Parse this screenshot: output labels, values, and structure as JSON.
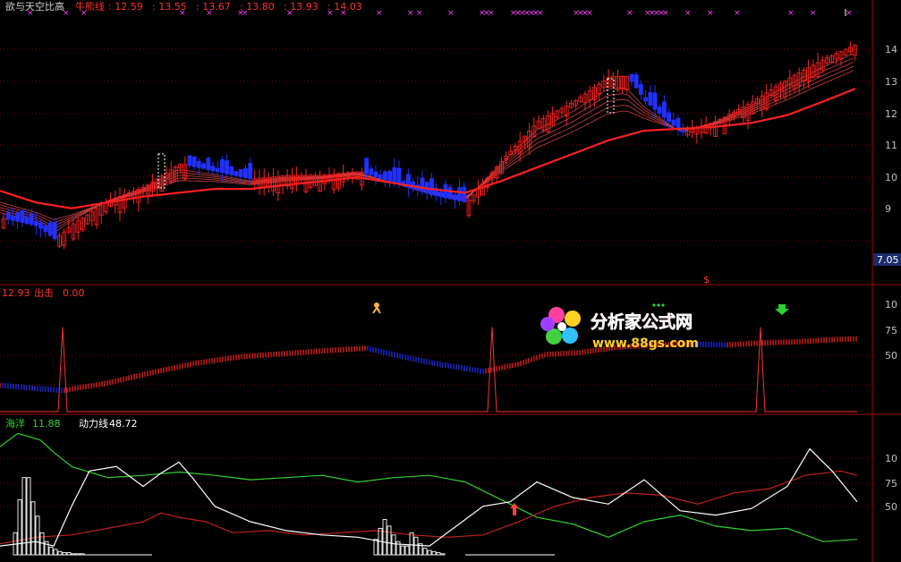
{
  "header": {
    "title": "欲与天空比高",
    "indicator_label": "牛熊线",
    "values": [
      "12.59",
      "13.55",
      "13.67",
      "13.80",
      "13.93",
      "14.03"
    ]
  },
  "panel1": {
    "axis_labels": [
      "14",
      "13",
      "12",
      "11",
      "10",
      "9"
    ],
    "price_tag": "7.05",
    "signal_char": "$"
  },
  "panel2": {
    "left_value": "12.93",
    "label": "出击",
    "value": "0.00",
    "axis_labels": [
      "10",
      "75",
      "50"
    ]
  },
  "panel3": {
    "label1": "海洋",
    "value1": "11.88",
    "label2": "动力线",
    "value2": "48.72",
    "axis_labels": [
      "10",
      "75",
      "50"
    ]
  },
  "watermark": {
    "site_name": "分析家公式网",
    "url": "www.88gs.com"
  },
  "colors": {
    "up": "#ff2020",
    "down": "#2030ff",
    "grid": "#7a0000",
    "header_text": "#ff3030",
    "white": "#ffffff",
    "green": "#30d030",
    "magenta": "#ff40ff"
  },
  "chart_data": [
    {
      "type": "line",
      "title": "欲与天空比高",
      "ylim": [
        8,
        14.5
      ],
      "series": [
        {
          "name": "牛熊线",
          "x": [
            0,
            40,
            80,
            120,
            160,
            200,
            240,
            280,
            320,
            360,
            400,
            440,
            480,
            520,
            560,
            600,
            640,
            680,
            720,
            760,
            800,
            840,
            880,
            920,
            958
          ],
          "values": [
            10.0,
            9.7,
            9.55,
            9.7,
            9.85,
            9.95,
            10.05,
            10.05,
            10.15,
            10.25,
            10.35,
            10.2,
            10.05,
            9.95,
            10.25,
            10.6,
            10.95,
            11.3,
            11.55,
            11.6,
            11.65,
            11.75,
            11.95,
            12.3,
            12.65
          ]
        },
        {
          "name": "",
          "x": [
            0,
            40,
            60,
            80,
            120,
            160,
            200,
            240,
            280,
            320,
            360,
            400,
            440,
            480,
            520,
            560,
            600,
            640,
            680,
            700,
            720,
            760,
            800,
            840,
            880,
            920,
            958
          ],
          "values": [
            9.3,
            9.1,
            8.75,
            9.15,
            9.75,
            10.1,
            10.7,
            10.5,
            10.3,
            10.4,
            10.4,
            10.5,
            10.2,
            9.9,
            9.7,
            10.8,
            11.8,
            12.3,
            12.95,
            12.95,
            12.3,
            11.5,
            11.8,
            12.3,
            12.9,
            13.4,
            13.8
          ]
        }
      ],
      "markers": {
        "sell_x": [
          187,
          530,
          790,
          870,
          945
        ]
      }
    },
    {
      "type": "line",
      "ylim": [
        0,
        110
      ],
      "series": [
        {
          "name": "",
          "x": [
            0,
            40,
            70,
            120,
            170,
            220,
            270,
            320,
            370,
            410,
            450,
            490,
            540,
            580,
            610,
            650,
            690,
            730,
            770,
            810,
            850,
            890,
            930,
            958
          ],
          "values": [
            25,
            22,
            20,
            27,
            37,
            46,
            52,
            55,
            58,
            60,
            52,
            45,
            38,
            45,
            54,
            56,
            61,
            63,
            64,
            63,
            65,
            66,
            68,
            69
          ]
        },
        {
          "name": "出击",
          "x": [
            0,
            65,
            70,
            75,
            545,
            550,
            555,
            845,
            850,
            855,
            958
          ],
          "values": [
            0,
            0,
            80,
            0,
            0,
            80,
            0,
            0,
            80,
            0,
            0
          ]
        }
      ]
    },
    {
      "type": "line",
      "ylim": [
        0,
        120
      ],
      "series": [
        {
          "name": "海洋",
          "x": [
            0,
            20,
            45,
            60,
            80,
            120,
            160,
            200,
            240,
            280,
            320,
            360,
            400,
            440,
            480,
            520,
            560,
            600,
            640,
            680,
            720,
            760,
            800,
            840,
            880,
            920,
            958
          ],
          "values": [
            98,
            110,
            104,
            93,
            80,
            70,
            72,
            75,
            72,
            68,
            70,
            72,
            66,
            70,
            72,
            66,
            50,
            34,
            28,
            16,
            30,
            36,
            26,
            22,
            24,
            12,
            14
          ]
        },
        {
          "name": "动力线",
          "x": [
            0,
            40,
            80,
            120,
            160,
            180,
            200,
            230,
            260,
            300,
            340,
            380,
            420,
            460,
            500,
            540,
            580,
            620,
            660,
            700,
            740,
            780,
            820,
            860,
            900,
            940,
            958
          ],
          "values": [
            10,
            16,
            18,
            24,
            30,
            38,
            34,
            30,
            20,
            22,
            18,
            20,
            22,
            18,
            16,
            18,
            30,
            44,
            52,
            56,
            54,
            46,
            56,
            60,
            72,
            76,
            72
          ]
        },
        {
          "name": "",
          "x": [
            0,
            40,
            60,
            80,
            100,
            130,
            160,
            180,
            200,
            215,
            240,
            280,
            320,
            360,
            400,
            440,
            480,
            520,
            540,
            570,
            600,
            640,
            680,
            720,
            760,
            800,
            840,
            880,
            905,
            930,
            958
          ],
          "values": [
            8,
            12,
            8,
            44,
            76,
            80,
            62,
            74,
            84,
            70,
            44,
            30,
            22,
            18,
            16,
            10,
            8,
            32,
            44,
            48,
            66,
            52,
            46,
            68,
            40,
            36,
            42,
            62,
            96,
            76,
            48
          ]
        }
      ],
      "histogram_clusters": [
        {
          "start_x": 15,
          "heights": [
            20,
            50,
            70,
            70,
            48,
            35,
            20,
            12,
            7,
            5,
            3,
            2,
            2,
            1,
            1,
            1
          ]
        },
        {
          "start_x": 418,
          "heights": [
            14,
            24,
            32,
            26,
            18,
            12,
            8,
            8,
            20,
            16,
            10,
            6,
            4,
            3,
            2,
            1
          ]
        }
      ]
    }
  ]
}
